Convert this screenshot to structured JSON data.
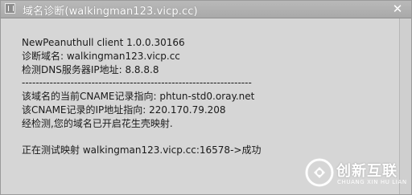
{
  "window": {
    "title": "域名诊断(walkingman123.vicp.cc)",
    "close_glyph": "✕"
  },
  "content": {
    "lines": [
      "NewPeanuthull client 1.0.0.30166",
      "诊断域名: walkingman123.vicp.cc",
      "检测DNS服务器IP地址: 8.8.8.8",
      "------------------------------------------------------------------",
      "该域名的当前CNAME记录指向: phtun-std0.oray.net",
      "该CNAME记录的IP地址指向: 220.170.79.208",
      "经检测,您的域名已开启花生壳映射.",
      "",
      "正在测试映射 walkingman123.vicp.cc:16578->成功"
    ]
  },
  "watermark": {
    "name": "创新互联",
    "subtitle": "CHUANG XIN HU LIAN"
  }
}
